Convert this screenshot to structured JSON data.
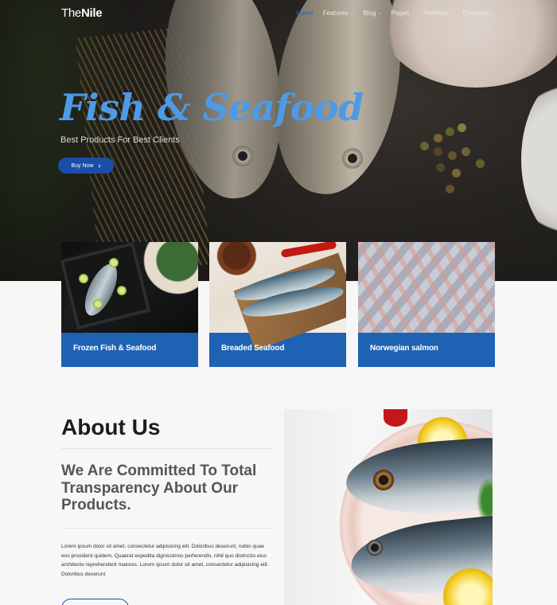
{
  "brand": {
    "logo_light": "The",
    "logo_bold": "Nile"
  },
  "nav": {
    "items": [
      {
        "label": "Home",
        "active": true,
        "dropdown": false
      },
      {
        "label": "Features",
        "dropdown": true
      },
      {
        "label": "Blog",
        "dropdown": true
      },
      {
        "label": "Pages",
        "dropdown": true
      },
      {
        "label": "Portfolio",
        "dropdown": true
      },
      {
        "label": "Elements",
        "dropdown": true
      }
    ]
  },
  "hero": {
    "title": "Fish & Seafood",
    "subtitle": "Best Products For Best Clients",
    "button_label": "Buy Now",
    "button_icon": "chevron-right-icon"
  },
  "categories": [
    {
      "label": "Frozen Fish & Seafood"
    },
    {
      "label": "Breaded Seafood"
    },
    {
      "label": "Norwegian salmon"
    }
  ],
  "about": {
    "title": "About Us",
    "subtitle": "We Are Committed To Total Transparency About Our Products.",
    "body": "Lorem ipsum dolor sit amet, consectetur adipisicing elit. Doloribus deserunt, nobis quae eos provident quidem. Quaerat expedita dignissimos perferendis, nihil quo distinctio eius architecto reprehenderit maiores. Lorem ipsum dolor sit amet, consectetur adipisicing elit. Doloribus deserunt"
  },
  "colors": {
    "accent": "#1d62b3",
    "hero_title": "#4d9ae6",
    "button": "#1a4ea8"
  }
}
